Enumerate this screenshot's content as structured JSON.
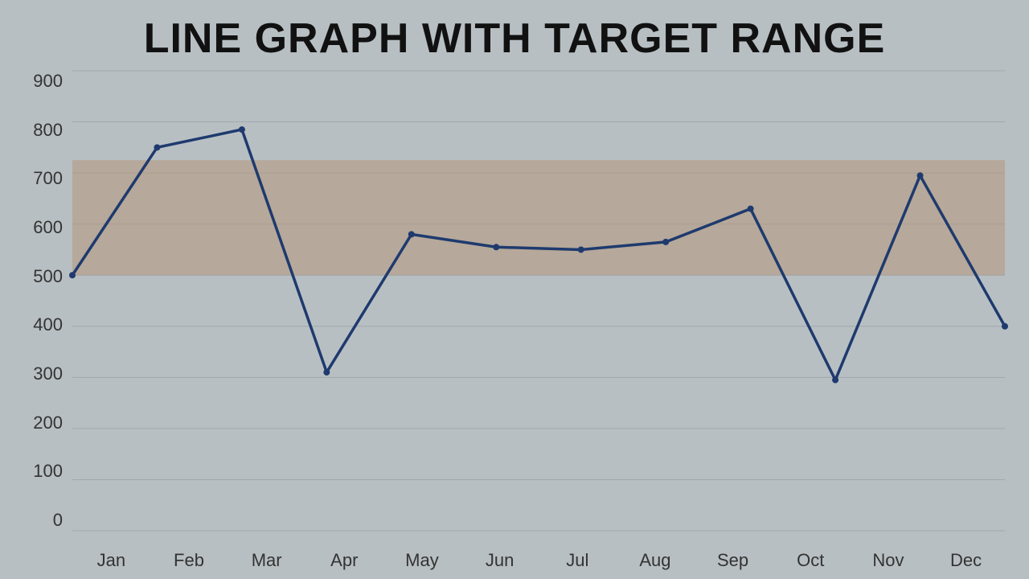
{
  "title": "LINE GRAPH WITH TARGET RANGE",
  "yAxis": {
    "labels": [
      "900",
      "800",
      "700",
      "600",
      "500",
      "400",
      "300",
      "200",
      "100",
      "0"
    ],
    "min": 0,
    "max": 900,
    "step": 100
  },
  "xAxis": {
    "labels": [
      "Jan",
      "Feb",
      "Mar",
      "Apr",
      "May",
      "Jun",
      "Jul",
      "Aug",
      "Sep",
      "Oct",
      "Nov",
      "Dec"
    ]
  },
  "targetRange": {
    "lower": 500,
    "upper": 725
  },
  "dataPoints": [
    500,
    750,
    785,
    310,
    580,
    555,
    550,
    565,
    630,
    295,
    695,
    400
  ],
  "colors": {
    "line": "#1e3a6e",
    "targetBand": "rgba(180,150,120,0.55)",
    "background": "#b8bfc3",
    "gridLine": "#a8b0b5"
  }
}
